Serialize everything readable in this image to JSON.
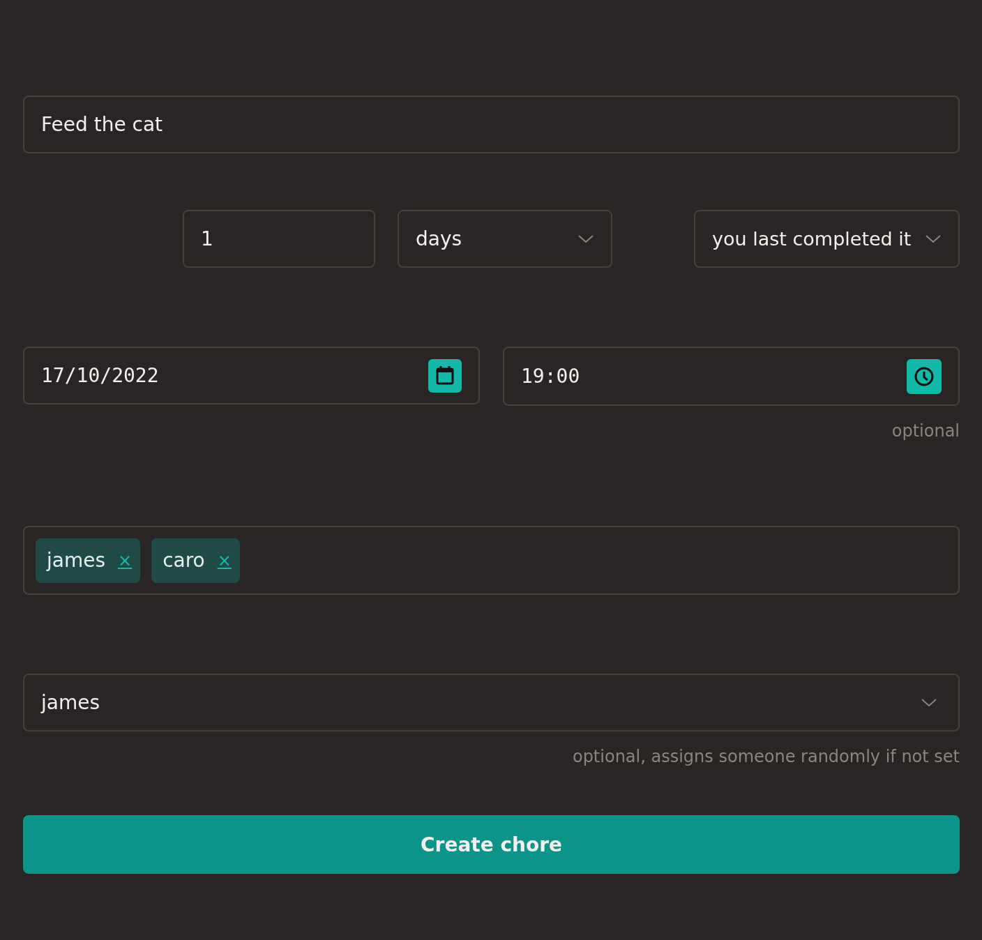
{
  "name_field": {
    "value": "Feed the cat"
  },
  "interval": {
    "value": "1",
    "unit": "days",
    "basis": "you last completed it"
  },
  "start": {
    "date": "17/10/2022",
    "time": "19:00",
    "time_hint": "optional"
  },
  "assignees": [
    {
      "name": "james",
      "remove": "×"
    },
    {
      "name": "caro",
      "remove": "×"
    }
  ],
  "assignee_select": {
    "value": "james",
    "hint": "optional, assigns someone randomly if not set"
  },
  "submit": "Create chore"
}
